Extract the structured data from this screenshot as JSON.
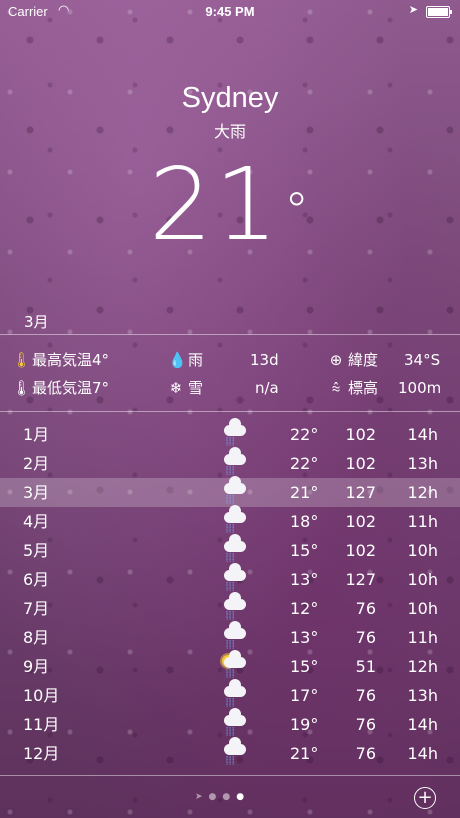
{
  "status": {
    "carrier": "Carrier",
    "time": "9:45 PM"
  },
  "city": "Sydney",
  "condition": "大雨",
  "temperature": "21",
  "degree_symbol": "°",
  "current_month": "3月",
  "stats": {
    "high_label": "最高気温4°",
    "low_label": "最低気温7°",
    "rain_label": "雨",
    "rain_value": "13d",
    "snow_label": "雪",
    "snow_value": "n/a",
    "lat_label": "緯度",
    "lat_value": "34°S",
    "alt_label": "標高",
    "alt_value": "100m"
  },
  "rows": [
    {
      "month": "1月",
      "temp": "22°",
      "rain": "102",
      "daylight": "14h",
      "icon": "rain-cloud-icon"
    },
    {
      "month": "2月",
      "temp": "22°",
      "rain": "102",
      "daylight": "13h",
      "icon": "rain-cloud-icon"
    },
    {
      "month": "3月",
      "temp": "21°",
      "rain": "127",
      "daylight": "12h",
      "icon": "rain-cloud-icon",
      "selected": true
    },
    {
      "month": "4月",
      "temp": "18°",
      "rain": "102",
      "daylight": "11h",
      "icon": "rain-cloud-icon"
    },
    {
      "month": "5月",
      "temp": "15°",
      "rain": "102",
      "daylight": "10h",
      "icon": "rain-cloud-icon"
    },
    {
      "month": "6月",
      "temp": "13°",
      "rain": "127",
      "daylight": "10h",
      "icon": "rain-cloud-icon"
    },
    {
      "month": "7月",
      "temp": "12°",
      "rain": "76",
      "daylight": "10h",
      "icon": "rain-cloud-icon"
    },
    {
      "month": "8月",
      "temp": "13°",
      "rain": "76",
      "daylight": "11h",
      "icon": "rain-cloud-icon"
    },
    {
      "month": "9月",
      "temp": "15°",
      "rain": "51",
      "daylight": "12h",
      "icon": "sun-cloud-rain-icon"
    },
    {
      "month": "10月",
      "temp": "17°",
      "rain": "76",
      "daylight": "13h",
      "icon": "rain-cloud-icon"
    },
    {
      "month": "11月",
      "temp": "19°",
      "rain": "76",
      "daylight": "14h",
      "icon": "rain-cloud-icon"
    },
    {
      "month": "12月",
      "temp": "21°",
      "rain": "76",
      "daylight": "14h",
      "icon": "rain-cloud-icon"
    }
  ],
  "pager": {
    "pages": 4,
    "active_page": 4
  },
  "colors": {
    "background": "#7b4a7a",
    "highlight": "rgba(255,255,255,0.22)",
    "rain": "#6fb0ff",
    "sun": "#f5c93a"
  }
}
